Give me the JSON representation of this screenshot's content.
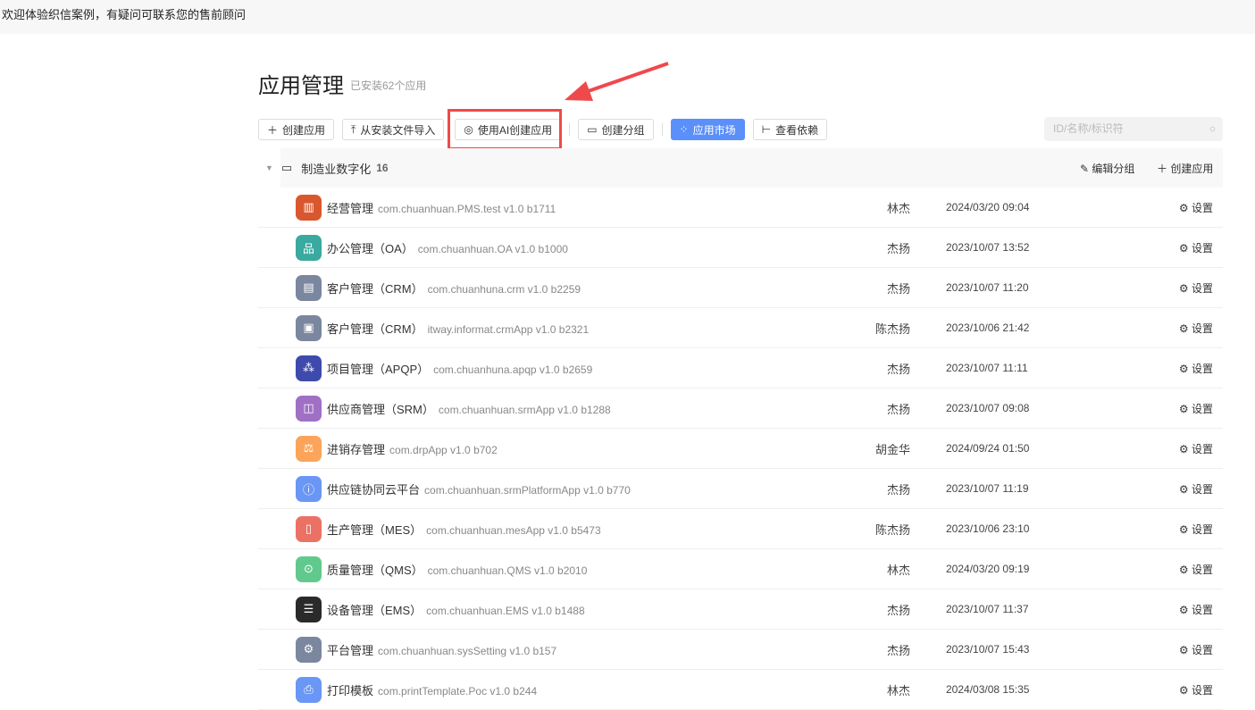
{
  "banner": "欢迎体验织信案例，有疑问可联系您的售前顾问",
  "page": {
    "title": "应用管理",
    "subtitle": "已安装62个应用"
  },
  "toolbar": {
    "create_app": "创建应用",
    "import": "从安装文件导入",
    "ai_create": "使用AI创建应用",
    "create_group": "创建分组",
    "market": "应用市场",
    "deps": "查看依赖"
  },
  "search": {
    "placeholder": "ID/名称/标识符"
  },
  "group": {
    "name": "制造业数字化",
    "count": "16",
    "edit": "编辑分组",
    "create": "创建应用"
  },
  "settings_label": "设置",
  "colors": {
    "accent": "#5b8ff9",
    "highlight": "#f0494b"
  },
  "apps": [
    {
      "name": "经营管理",
      "id": "com.chuanhuan.PMS.test  v1.0 b1711",
      "owner": "林杰",
      "date": "2024/03/20 09:04",
      "color": "#d9572e",
      "icon": "▥"
    },
    {
      "name": "办公管理（OA）",
      "id": "com.chuanhuan.OA  v1.0 b1000",
      "owner": "杰扬",
      "date": "2023/10/07 13:52",
      "color": "#3aa9a0",
      "icon": "品"
    },
    {
      "name": "客户管理（CRM）",
      "id": "com.chuanhuna.crm  v1.0 b2259",
      "owner": "杰扬",
      "date": "2023/10/07 11:20",
      "color": "#7b879f",
      "icon": "▤"
    },
    {
      "name": "客户管理（CRM）",
      "id": "itway.informat.crmApp  v1.0 b2321",
      "owner": "陈杰扬",
      "date": "2023/10/06 21:42",
      "color": "#7b879f",
      "icon": "▣"
    },
    {
      "name": "项目管理（APQP）",
      "id": "com.chuanhuna.apqp  v1.0 b2659",
      "owner": "杰扬",
      "date": "2023/10/07 11:11",
      "color": "#3f4aad",
      "icon": "⁂"
    },
    {
      "name": "供应商管理（SRM）",
      "id": "com.chuanhuan.srmApp  v1.0 b1288",
      "owner": "杰扬",
      "date": "2023/10/07 09:08",
      "color": "#a070c4",
      "icon": "◫"
    },
    {
      "name": "进销存管理",
      "id": "com.drpApp  v1.0 b702",
      "owner": "胡金华",
      "date": "2024/09/24 01:50",
      "color": "#fba45a",
      "icon": "⚖"
    },
    {
      "name": "供应链协同云平台",
      "id": "com.chuanhuan.srmPlatformApp  v1.0 b770",
      "owner": "杰扬",
      "date": "2023/10/07 11:19",
      "color": "#6a97f5",
      "icon": "ⓘ"
    },
    {
      "name": "生产管理（MES）",
      "id": "com.chuanhuan.mesApp  v1.0 b5473",
      "owner": "陈杰扬",
      "date": "2023/10/06 23:10",
      "color": "#ec7165",
      "icon": "▯"
    },
    {
      "name": "质量管理（QMS）",
      "id": "com.chuanhuan.QMS  v1.0 b2010",
      "owner": "林杰",
      "date": "2024/03/20 09:19",
      "color": "#62c98e",
      "icon": "⊙"
    },
    {
      "name": "设备管理（EMS）",
      "id": "com.chuanhuan.EMS  v1.0 b1488",
      "owner": "杰扬",
      "date": "2023/10/07 11:37",
      "color": "#2a2a2a",
      "icon": "☰"
    },
    {
      "name": "平台管理",
      "id": "com.chuanhuan.sysSetting  v1.0 b157",
      "owner": "杰扬",
      "date": "2023/10/07 15:43",
      "color": "#7b879f",
      "icon": "⚙"
    },
    {
      "name": "打印模板",
      "id": "com.printTemplate.Poc  v1.0 b244",
      "owner": "林杰",
      "date": "2024/03/08 15:35",
      "color": "#6a97f5",
      "icon": "⎙"
    }
  ]
}
